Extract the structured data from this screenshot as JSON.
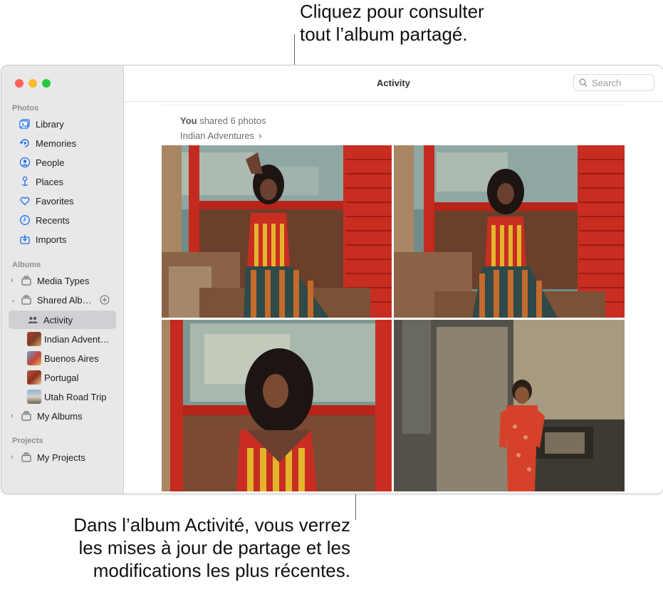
{
  "callouts": {
    "top_line1": "Cliquez pour consulter",
    "top_line2": "tout l’album partagé.",
    "bottom_line1": "Dans l’album Activité, vous verrez",
    "bottom_line2": "les mises à jour de partage et les",
    "bottom_line3": "modifications les plus récentes."
  },
  "sidebar": {
    "photos_heading": "Photos",
    "photos_items": [
      {
        "label": "Library",
        "icon": "library-icon"
      },
      {
        "label": "Memories",
        "icon": "memories-icon"
      },
      {
        "label": "People",
        "icon": "people-icon"
      },
      {
        "label": "Places",
        "icon": "places-icon"
      },
      {
        "label": "Favorites",
        "icon": "favorites-icon"
      },
      {
        "label": "Recents",
        "icon": "recents-icon"
      },
      {
        "label": "Imports",
        "icon": "imports-icon"
      }
    ],
    "albums_heading": "Albums",
    "media_types": "Media Types",
    "shared_albums": "Shared Albu…",
    "activity": "Activity",
    "shared_list": [
      "Indian Advent…",
      "Buenos Aires",
      "Portugal",
      "Utah Road Trip"
    ],
    "my_albums": "My Albums",
    "projects_heading": "Projects",
    "my_projects": "My Projects"
  },
  "toolbar": {
    "title": "Activity",
    "search_placeholder": "Search"
  },
  "activity": {
    "you": "You",
    "shared_text": " shared 6 photos",
    "album_name": "Indian Adventures",
    "chevron": "›"
  },
  "colors": {
    "accent": "#1d6ff2",
    "sidebar_bg": "#e8e8e8",
    "selected_bg": "#d0d0d4"
  }
}
